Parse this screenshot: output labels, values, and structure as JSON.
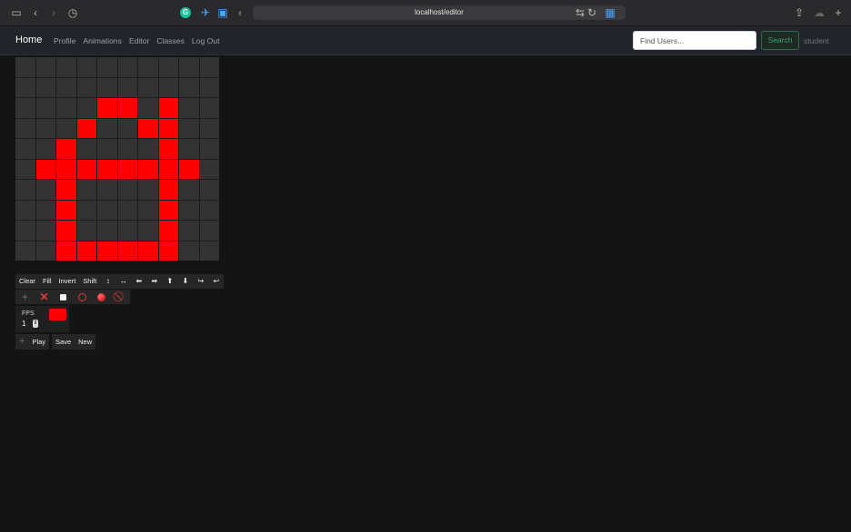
{
  "browser": {
    "url": "localhost/editor",
    "icons": [
      "sidebar-icon",
      "back-icon",
      "forward-icon",
      "history-icon",
      "grammarly-icon",
      "accessibility-icon",
      "bookmark-icon",
      "shield-icon",
      "translate-icon",
      "reload-icon",
      "reader-icon",
      "share-icon",
      "cloud-icon",
      "new-tab-icon"
    ]
  },
  "navbar": {
    "brand": "Home",
    "links": [
      "Profile",
      "Animations",
      "Editor",
      "Classes",
      "Log Out"
    ],
    "search_placeholder": "Find Users...",
    "search_label": "Search",
    "username": "student"
  },
  "editor": {
    "grid": {
      "columns": 10,
      "rows": 10,
      "on_color": "#ff0000",
      "off_color": "#333333",
      "cells": [
        [
          0,
          0,
          0,
          0,
          0,
          0,
          0,
          0,
          0,
          0
        ],
        [
          0,
          0,
          0,
          0,
          0,
          0,
          0,
          0,
          0,
          0
        ],
        [
          0,
          0,
          0,
          0,
          1,
          1,
          0,
          1,
          0,
          0
        ],
        [
          0,
          0,
          0,
          1,
          0,
          0,
          1,
          1,
          0,
          0
        ],
        [
          0,
          0,
          1,
          0,
          0,
          0,
          0,
          1,
          0,
          0
        ],
        [
          0,
          1,
          1,
          1,
          1,
          1,
          1,
          1,
          1,
          0
        ],
        [
          0,
          0,
          1,
          0,
          0,
          0,
          0,
          1,
          0,
          0
        ],
        [
          0,
          0,
          1,
          0,
          0,
          0,
          0,
          1,
          0,
          0
        ],
        [
          0,
          0,
          1,
          0,
          0,
          0,
          0,
          1,
          0,
          0
        ],
        [
          0,
          0,
          1,
          1,
          1,
          1,
          1,
          1,
          0,
          0
        ]
      ]
    },
    "toolbar": {
      "clear": "Clear",
      "fill": "Fill",
      "invert": "Invert",
      "shift": "Shift",
      "shift_arrows": [
        "↕",
        "↔",
        "⬅",
        "➡",
        "⬆",
        "⬇",
        "↪",
        "↩"
      ]
    },
    "tools": [
      "plus-icon",
      "cross-icon",
      "square-icon",
      "circle-outline-icon",
      "circle-filled-icon",
      "no-entry-icon"
    ],
    "fps": {
      "label": "FPS",
      "value": "1"
    },
    "color": "#ff0000",
    "frame_controls": {
      "play": "Play",
      "save": "Save",
      "new": "New"
    }
  }
}
